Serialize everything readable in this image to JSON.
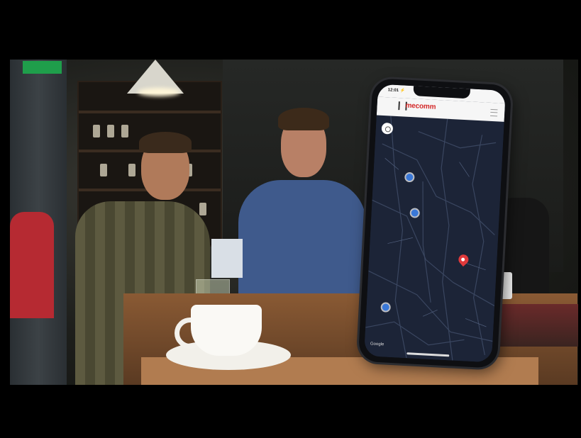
{
  "scene": {
    "description_tags": [
      "cafe",
      "two-men",
      "coffee-cup",
      "smartphone",
      "map-app"
    ],
    "status_time": "12:01 ⚡",
    "app_logo": "mecomm",
    "map_label": "Google",
    "colors": {
      "brand_red": "#d42a2a",
      "map_bg": "#1c2437",
      "pin_blue": "#3a78d8",
      "pin_red": "#e0393b"
    }
  }
}
